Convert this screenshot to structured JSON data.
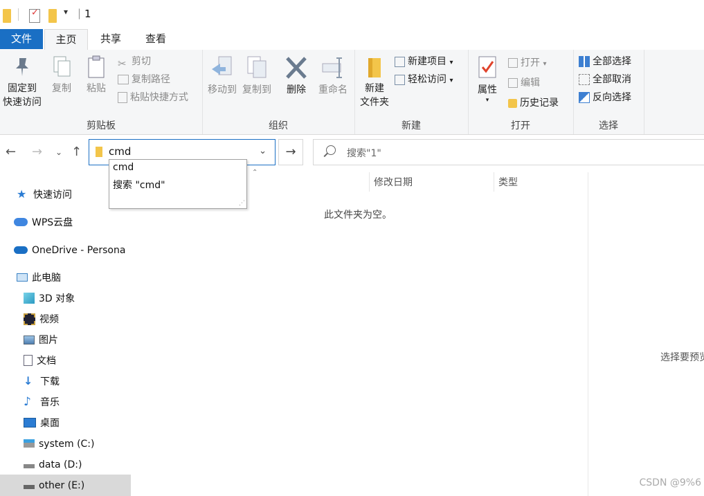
{
  "titlebar": {
    "path_sep": "|",
    "folder_name": "1"
  },
  "tabs": {
    "file": "文件",
    "home": "主页",
    "share": "共享",
    "view": "查看"
  },
  "ribbon": {
    "pin_line1": "固定到",
    "pin_line2": "快速访问",
    "copy": "复制",
    "paste": "粘贴",
    "cut": "剪切",
    "copy_path": "复制路径",
    "paste_shortcut": "粘贴快捷方式",
    "clipboard_group": "剪贴板",
    "move_to": "移动到",
    "copy_to": "复制到",
    "delete": "删除",
    "rename": "重命名",
    "organize_group": "组织",
    "new_folder_line1": "新建",
    "new_folder_line2": "文件夹",
    "new_item": "新建项目",
    "easy_access": "轻松访问",
    "new_group": "新建",
    "properties": "属性",
    "open": "打开",
    "edit": "编辑",
    "history": "历史记录",
    "open_group": "打开",
    "select_all": "全部选择",
    "select_none": "全部取消",
    "invert_selection": "反向选择",
    "select_group": "选择"
  },
  "address": {
    "value": "cmd"
  },
  "search": {
    "placeholder": "搜索\"1\""
  },
  "dropdown": {
    "item1": "cmd",
    "item2": "搜索 \"cmd\""
  },
  "nav": {
    "quick_access": "快速访问",
    "wps_cloud": "WPS云盘",
    "onedrive": "OneDrive - Persona",
    "this_pc": "此电脑",
    "objects3d": "3D 对象",
    "videos": "视频",
    "pictures": "图片",
    "documents": "文档",
    "downloads": "下载",
    "music": "音乐",
    "desktop": "桌面",
    "drive_c": "system (C:)",
    "drive_d": "data (D:)",
    "drive_e": "other (E:)"
  },
  "columns": {
    "modified": "修改日期",
    "type": "类型"
  },
  "main": {
    "empty": "此文件夹为空。",
    "preview": "选择要预览"
  },
  "watermark": "CSDN @9%6",
  "colors": {
    "accent": "#1a6fc4",
    "selected_row": "#d9d9d9",
    "folder": "#f3c54a"
  }
}
